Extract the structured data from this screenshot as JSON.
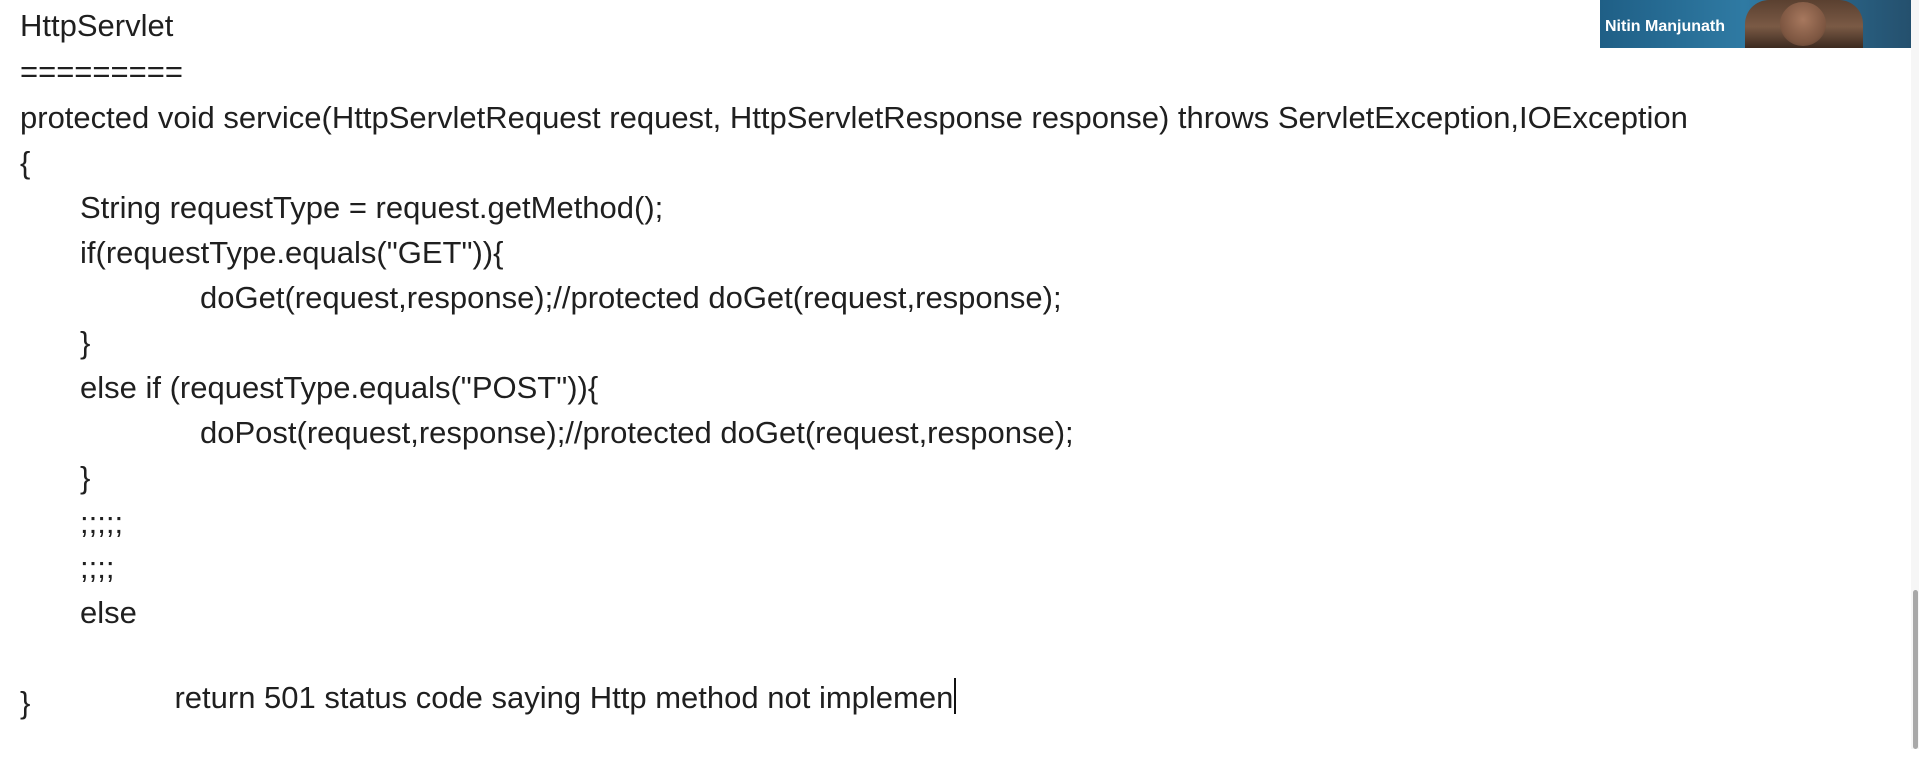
{
  "document": {
    "lines": [
      "HttpServlet",
      "=========",
      "protected void service(HttpServletRequest request, HttpServletResponse response) throws ServletException,IOException",
      "{",
      "String requestType = request.getMethod();",
      "if(requestType.equals(\"GET\")){",
      "doGet(request,response);//protected doGet(request,response);",
      "}",
      "else if (requestType.equals(\"POST\")){",
      "doPost(request,response);//protected doGet(request,response);",
      "}",
      ";;;;;",
      ";;;;",
      "else",
      "return 501 status code saying Http method not implemen",
      "}"
    ]
  },
  "video_tile": {
    "participant_name": "Nitin Manjunath"
  }
}
